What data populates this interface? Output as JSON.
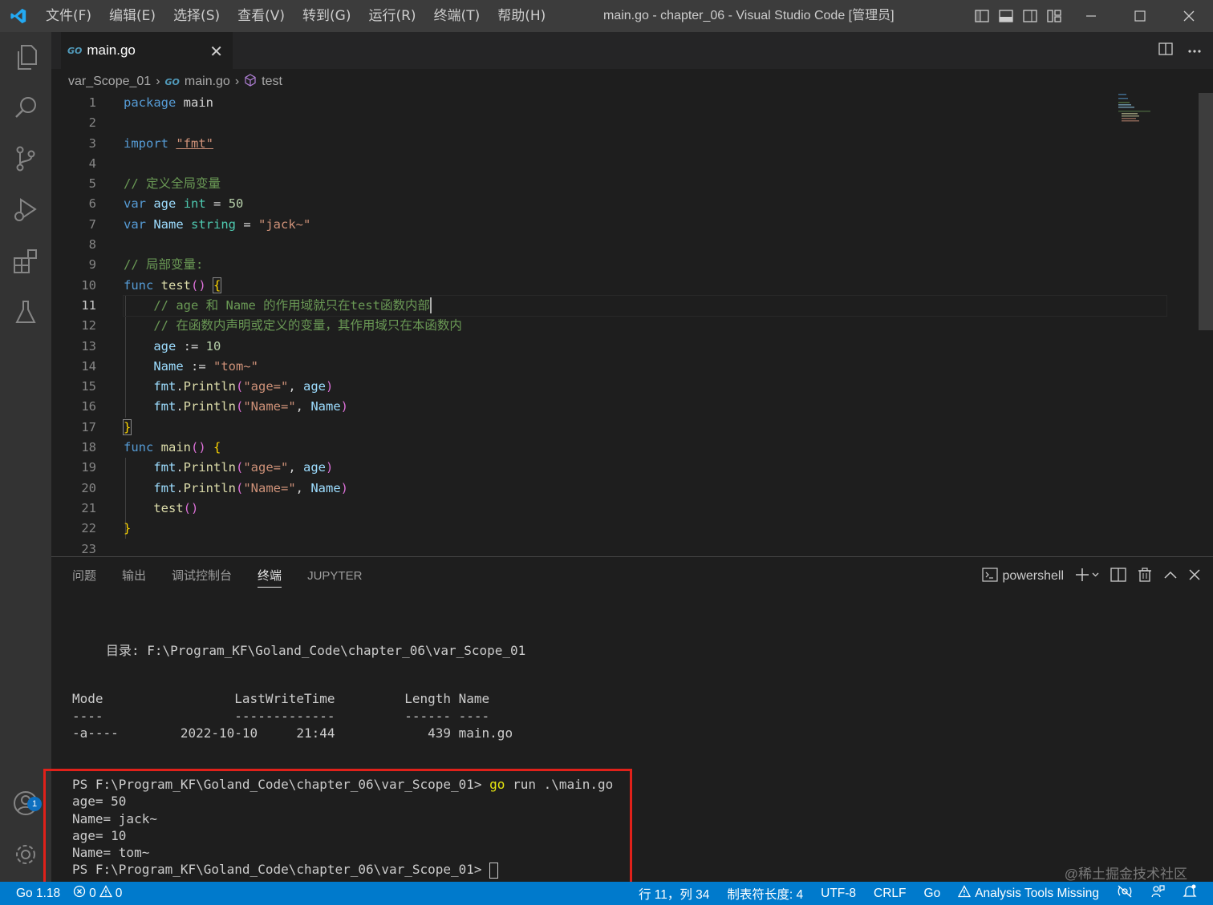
{
  "window": {
    "title": "main.go - chapter_06 - Visual Studio Code [管理员]",
    "menu": [
      "文件(F)",
      "编辑(E)",
      "选择(S)",
      "查看(V)",
      "转到(G)",
      "运行(R)",
      "终端(T)",
      "帮助(H)"
    ]
  },
  "activity": {
    "account_badge": "1"
  },
  "tab": {
    "icon_text": "GO",
    "label": "main.go",
    "close": "✕"
  },
  "breadcrumb": {
    "folder": "var_Scope_01",
    "file": "main.go",
    "symbol": "test"
  },
  "editor": {
    "line_numbers": [
      "1",
      "2",
      "3",
      "4",
      "5",
      "6",
      "7",
      "8",
      "9",
      "10",
      "11",
      "12",
      "13",
      "14",
      "15",
      "16",
      "17",
      "18",
      "19",
      "20",
      "21",
      "22",
      "23"
    ],
    "active_line": "11",
    "code": {
      "l1_kw": "package",
      "l1_name": " main",
      "l3_kw": "import",
      "l3_str": "\"fmt\"",
      "l5": "// 定义全局变量",
      "l6_kw": "var",
      "l6_id": "age",
      "l6_ty": "int",
      "l6_eq": " = ",
      "l6_num": "50",
      "l7_kw": "var",
      "l7_id": "Name",
      "l7_ty": "string",
      "l7_eq": " = ",
      "l7_str": "\"jack~\"",
      "l9": "// 局部变量:",
      "l10_kw": "func",
      "l10_fn": "test",
      "l11": "// age 和 Name 的作用域就只在test函数内部",
      "l12": "// 在函数内声明或定义的变量，其作用域只在本函数内",
      "l13_id": "age",
      "l13_op": " := ",
      "l13_num": "10",
      "l14_id": "Name",
      "l14_op": " := ",
      "l14_str": "\"tom~\"",
      "l15_pkg": "fmt",
      "l15_fn": "Println",
      "l15_str": "\"age=\"",
      "l15_arg": "age",
      "l16_pkg": "fmt",
      "l16_fn": "Println",
      "l16_str": "\"Name=\"",
      "l16_arg": "Name",
      "l18_kw": "func",
      "l18_fn": "main",
      "l19_pkg": "fmt",
      "l19_fn": "Println",
      "l19_str": "\"age=\"",
      "l19_arg": "age",
      "l20_pkg": "fmt",
      "l20_fn": "Println",
      "l20_str": "\"Name=\"",
      "l20_arg": "Name",
      "l21_fn": "test"
    }
  },
  "panel": {
    "tabs": [
      "问题",
      "输出",
      "调试控制台",
      "终端",
      "JUPYTER"
    ],
    "active_tab": "终端",
    "shell_label": "powershell",
    "terminal": {
      "dir_line": "目录: F:\\Program_KF\\Goland_Code\\chapter_06\\var_Scope_01",
      "header": "Mode                 LastWriteTime         Length Name",
      "dashes": "----                 -------------         ------ ----",
      "file_row": "-a----        2022-10-10     21:44            439 main.go",
      "prompt1": "PS F:\\Program_KF\\Goland_Code\\chapter_06\\var_Scope_01> ",
      "cmd_go": "go",
      "cmd_rest": " run .\\main.go",
      "out1": "age= 50",
      "out2": "Name= jack~",
      "out3": "age= 10",
      "out4": "Name= tom~",
      "prompt2": "PS F:\\Program_KF\\Goland_Code\\chapter_06\\var_Scope_01> "
    }
  },
  "watermark": "@稀土掘金技术社区",
  "status": {
    "go_version": "Go 1.18",
    "errors": "0",
    "warnings": "0",
    "position": "行 11，列 34",
    "tab_size": "制表符长度: 4",
    "encoding": "UTF-8",
    "eol": "CRLF",
    "language": "Go",
    "analysis": "Analysis Tools Missing"
  },
  "colors": {
    "accent": "#007acc",
    "highlight_box": "#e0211a"
  }
}
